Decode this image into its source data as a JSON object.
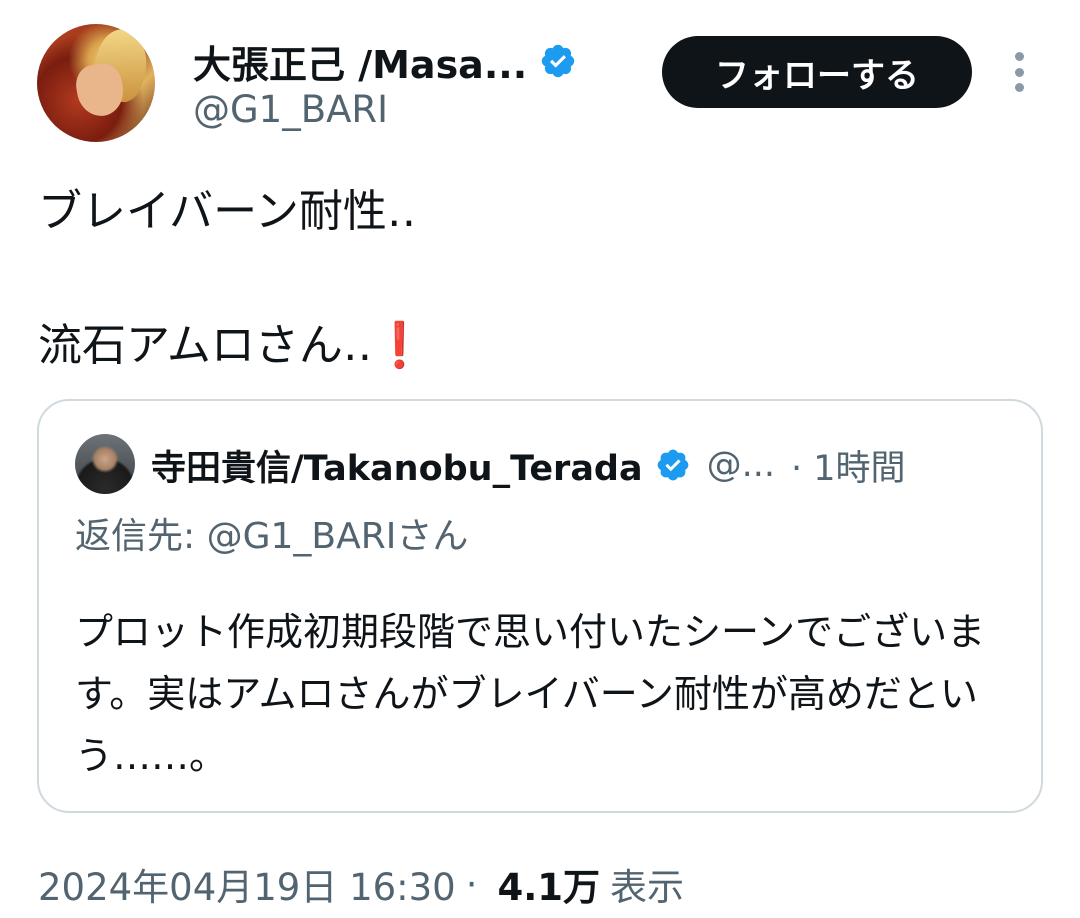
{
  "author": {
    "display_name": "大張正己 /Masa...",
    "handle": "@G1_BARI",
    "verified": true
  },
  "follow_button_label": "フォローする",
  "tweet": {
    "text": "ブレイバーン耐性‥\n\n流石アムロさん‥",
    "emoji": "❗"
  },
  "quote": {
    "display_name": "寺田貴信/Takanobu_Terada",
    "handle": "@...",
    "time": "· 1時間",
    "reply_to": "返信先: @G1_BARIさん",
    "text": "プロット作成初期段階で思い付いたシーンでございます。実はアムロさんがブレイバーン耐性が高めだという……。"
  },
  "meta": {
    "timestamp": "2024年04月19日 16:30",
    "separator": "·",
    "views_count": "4.1万",
    "views_label": "表示"
  },
  "colors": {
    "text": "#0f1419",
    "secondary": "#536471",
    "verified": "#1d9bf0",
    "border": "#cfd9de",
    "follow_bg": "#0f1419"
  },
  "icons": {
    "verified": "verified-badge-icon",
    "more": "more-vertical-icon",
    "exclamation": "red-exclamation-emoji"
  }
}
